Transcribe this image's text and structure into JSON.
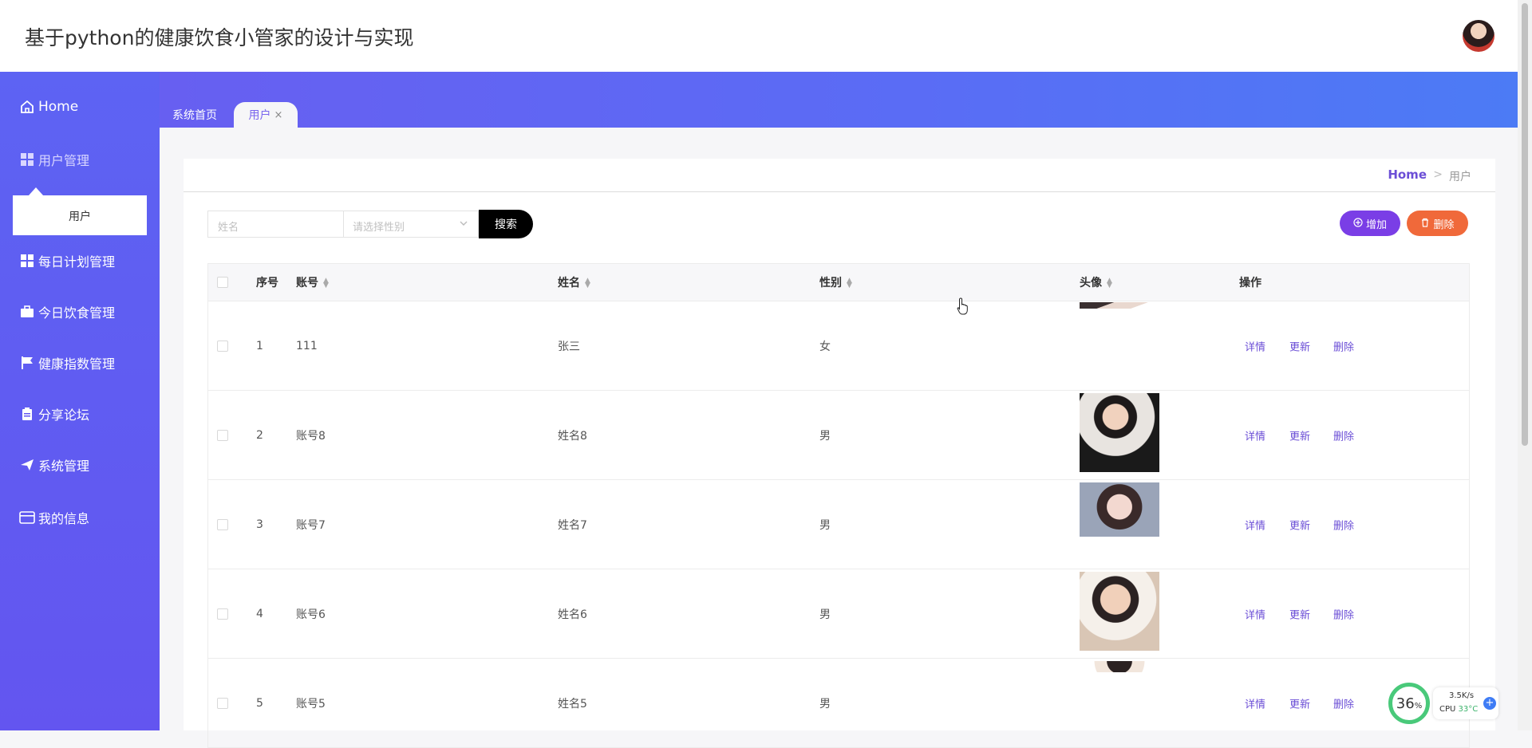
{
  "app": {
    "title": "基于python的健康饮食小管家的设计与实现"
  },
  "sidebar": {
    "items": [
      {
        "label": "Home",
        "icon": "home-icon"
      },
      {
        "label": "用户管理",
        "icon": "grid-icon"
      },
      {
        "label": "每日计划管理",
        "icon": "grid-icon"
      },
      {
        "label": "今日饮食管理",
        "icon": "briefcase-icon"
      },
      {
        "label": "健康指数管理",
        "icon": "flag-icon"
      },
      {
        "label": "分享论坛",
        "icon": "clipboard-icon"
      },
      {
        "label": "系统管理",
        "icon": "send-icon"
      },
      {
        "label": "我的信息",
        "icon": "card-icon"
      }
    ],
    "submenu": {
      "label": "用户"
    }
  },
  "tabs": [
    {
      "label": "系统首页"
    },
    {
      "label": "用户",
      "close": "×"
    }
  ],
  "breadcrumb": {
    "home": "Home",
    "separator": ">",
    "current": "用户"
  },
  "search": {
    "name_placeholder": "姓名",
    "sex_placeholder": "请选择性别",
    "button": "搜索"
  },
  "actions": {
    "add": "增加",
    "delete": "删除"
  },
  "table": {
    "headers": {
      "index": "序号",
      "account": "账号",
      "name": "姓名",
      "sex": "性别",
      "avatar": "头像",
      "ops": "操作"
    },
    "ops": {
      "detail": "详情",
      "update": "更新",
      "delete": "删除"
    },
    "rows": [
      {
        "index": "1",
        "account": "111",
        "name": "张三",
        "sex": "女"
      },
      {
        "index": "2",
        "account": "账号8",
        "name": "姓名8",
        "sex": "男"
      },
      {
        "index": "3",
        "account": "账号7",
        "name": "姓名7",
        "sex": "男"
      },
      {
        "index": "4",
        "account": "账号6",
        "name": "姓名6",
        "sex": "男"
      },
      {
        "index": "5",
        "account": "账号5",
        "name": "姓名5",
        "sex": "男"
      }
    ]
  },
  "widget": {
    "percent": "36",
    "percent_unit": "%",
    "net": "3.5K/s",
    "cpu_label": "CPU",
    "cpu_temp": "33°C"
  },
  "colors": {
    "sidebar": "#6355f0",
    "accent": "#6b4ed6",
    "add_button": "#7a3ee6",
    "delete_button": "#f0693a"
  }
}
